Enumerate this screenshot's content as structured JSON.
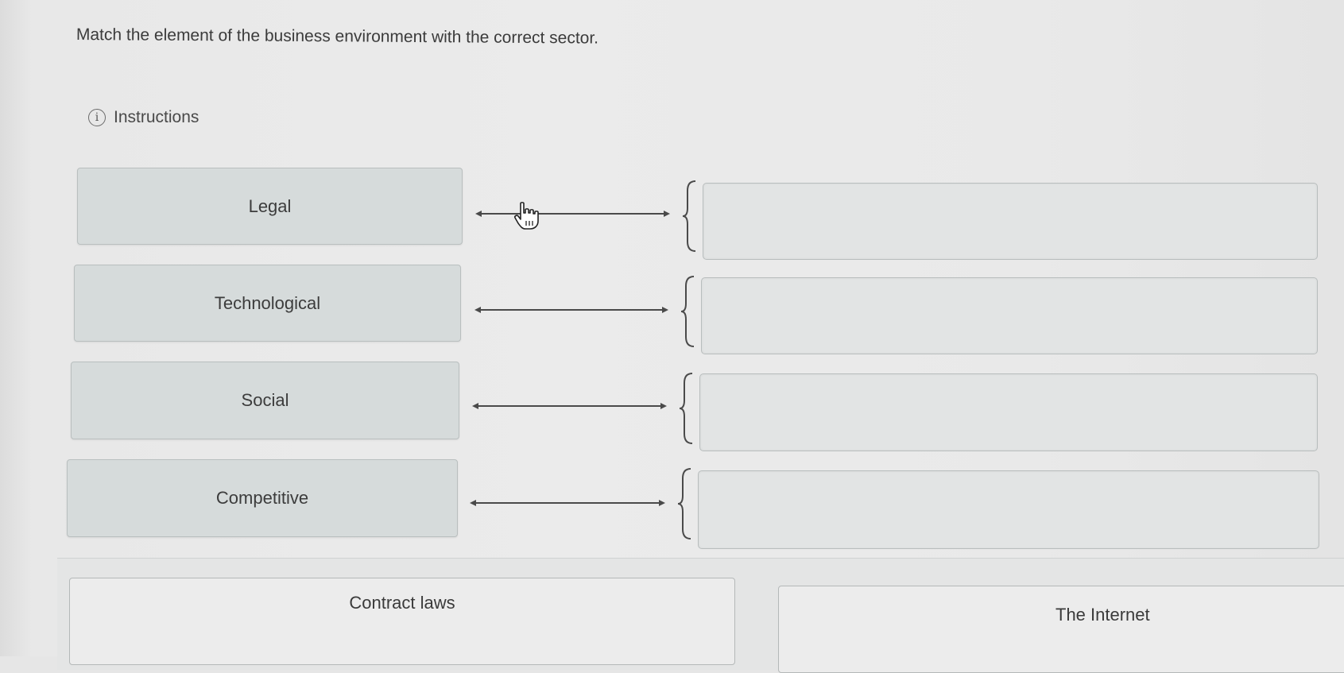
{
  "question": {
    "text": "Match the element of the business environment with the correct sector."
  },
  "instructions": {
    "icon": "info-icon",
    "icon_glyph": "i",
    "label": "Instructions"
  },
  "terms": [
    {
      "label": "Legal"
    },
    {
      "label": "Technological"
    },
    {
      "label": "Social"
    },
    {
      "label": "Competitive"
    }
  ],
  "answer_choices": [
    {
      "label": "Contract laws"
    },
    {
      "label": "The Internet"
    }
  ],
  "colors": {
    "term_bg": "#d6dbdb",
    "slot_bg": "#e2e4e4",
    "choice_bg": "#ececec",
    "text": "#3a3a3a"
  }
}
